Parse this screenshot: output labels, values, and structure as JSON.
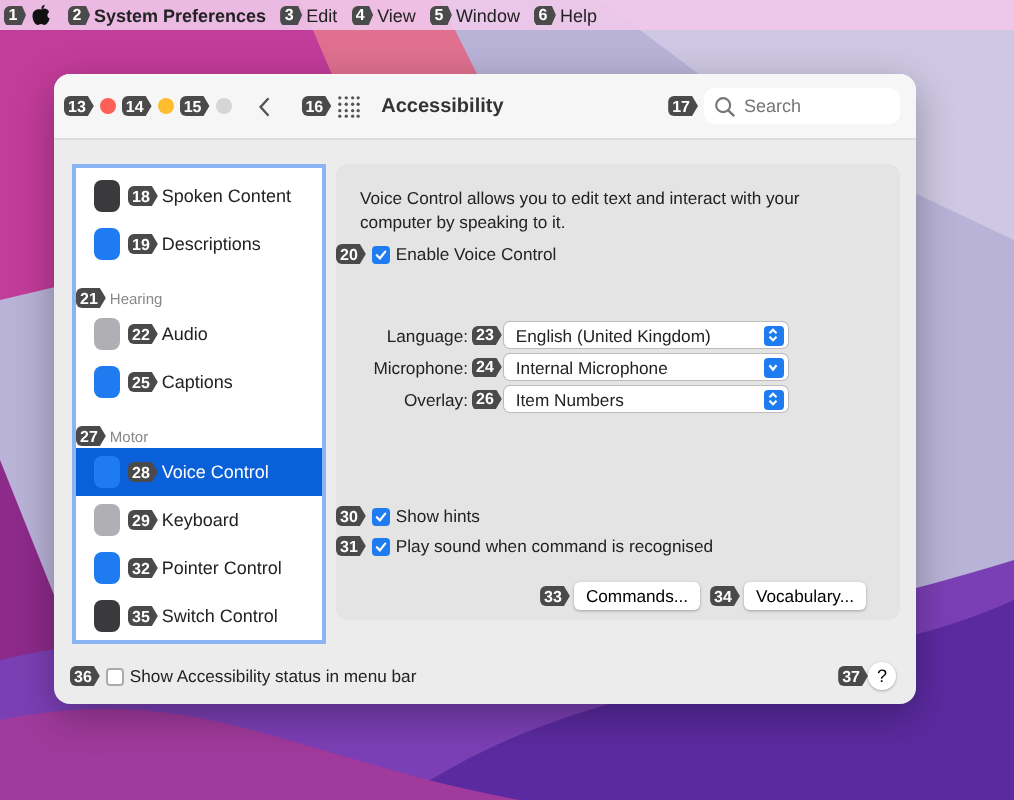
{
  "menu_bar": {
    "apple_marker": "1",
    "items": [
      {
        "label": "System Preferences",
        "marker": "2",
        "bold": true
      },
      {
        "label": "Edit",
        "marker": "3",
        "bold": false
      },
      {
        "label": "View",
        "marker": "4",
        "bold": false
      },
      {
        "label": "Window",
        "marker": "5",
        "bold": false
      },
      {
        "label": "Help",
        "marker": "6",
        "bold": false
      }
    ]
  },
  "window": {
    "title": "Accessibility",
    "controls": [
      {
        "kind": "close",
        "marker": "13"
      },
      {
        "kind": "minimize",
        "marker": "14"
      },
      {
        "kind": "zoom",
        "marker": "15"
      }
    ],
    "grid_marker": "16",
    "search": {
      "placeholder": "Search",
      "marker": "17"
    }
  },
  "sidebar": {
    "items": [
      {
        "kind": "item",
        "label": "Spoken Content",
        "color": "#3a3a3c",
        "marker": "18",
        "selected": false
      },
      {
        "kind": "item",
        "label": "Descriptions",
        "color": "#1f7cf0",
        "marker": "19",
        "selected": false
      },
      {
        "kind": "header",
        "label": "Hearing",
        "marker": "21"
      },
      {
        "kind": "item",
        "label": "Audio",
        "color": "#b0b0b4",
        "marker": "22",
        "selected": false
      },
      {
        "kind": "item",
        "label": "Captions",
        "color": "#1f7cf0",
        "marker": "25",
        "selected": false
      },
      {
        "kind": "header",
        "label": "Motor",
        "marker": "27"
      },
      {
        "kind": "item",
        "label": "Voice Control",
        "color": "#1f7cf0",
        "marker": "28",
        "selected": true
      },
      {
        "kind": "item",
        "label": "Keyboard",
        "color": "#b0b0b4",
        "marker": "29",
        "selected": false
      },
      {
        "kind": "item",
        "label": "Pointer Control",
        "color": "#1f7cf0",
        "marker": "32",
        "selected": false
      },
      {
        "kind": "item",
        "label": "Switch Control",
        "color": "#3a3a3c",
        "marker": "35",
        "selected": false
      }
    ]
  },
  "panel": {
    "description": "Voice Control allows you to edit text and interact with your computer by speaking to it.",
    "enable": {
      "label": "Enable Voice Control",
      "checked": true,
      "marker": "20"
    },
    "settings": [
      {
        "label": "Language:",
        "value": "English (United Kingdom)",
        "kind": "popup",
        "marker": "23"
      },
      {
        "label": "Microphone:",
        "value": "Internal Microphone",
        "kind": "pulldown",
        "marker": "24"
      },
      {
        "label": "Overlay:",
        "value": "Item Numbers",
        "kind": "popup",
        "marker": "26"
      }
    ],
    "options": [
      {
        "label": "Show hints",
        "checked": true,
        "marker": "30"
      },
      {
        "label": "Play sound when command is recognised",
        "checked": true,
        "marker": "31"
      }
    ],
    "buttons": [
      {
        "label": "Commands...",
        "marker": "33"
      },
      {
        "label": "Vocabulary...",
        "marker": "34"
      }
    ]
  },
  "footer": {
    "status": {
      "label": "Show Accessibility status in menu bar",
      "checked": false,
      "marker": "36"
    },
    "help": {
      "label": "?",
      "marker": "37"
    }
  }
}
